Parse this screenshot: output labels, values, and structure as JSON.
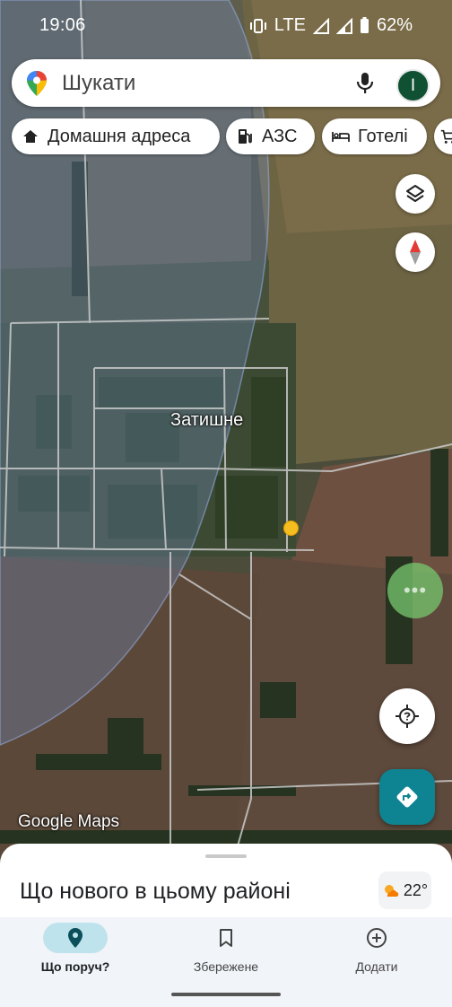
{
  "status_bar": {
    "time": "19:06",
    "network": "LTE",
    "battery": "62%"
  },
  "search": {
    "placeholder": "Шукати",
    "avatar_letter": "I"
  },
  "chips": [
    {
      "label": "Домашня адреса",
      "icon": "home-icon"
    },
    {
      "label": "АЗС",
      "icon": "gas-station-icon"
    },
    {
      "label": "Готелі",
      "icon": "hotel-icon"
    },
    {
      "label": "",
      "icon": "shopping-cart-icon"
    }
  ],
  "map": {
    "place_label": "Затишне",
    "watermark": "Google Maps"
  },
  "sheet": {
    "title": "Що нового в цьому районі",
    "weather_temp": "22°"
  },
  "nav": [
    {
      "label": "Що поруч?",
      "icon": "location-pin-icon",
      "active": true
    },
    {
      "label": "Збережене",
      "icon": "bookmark-icon",
      "active": false
    },
    {
      "label": "Додати",
      "icon": "add-circle-icon",
      "active": false
    }
  ],
  "colors": {
    "accent": "#0e8391",
    "avatar": "#0f5132",
    "active_nav": "#bfe3ec",
    "poi": "#f5bd1f"
  }
}
